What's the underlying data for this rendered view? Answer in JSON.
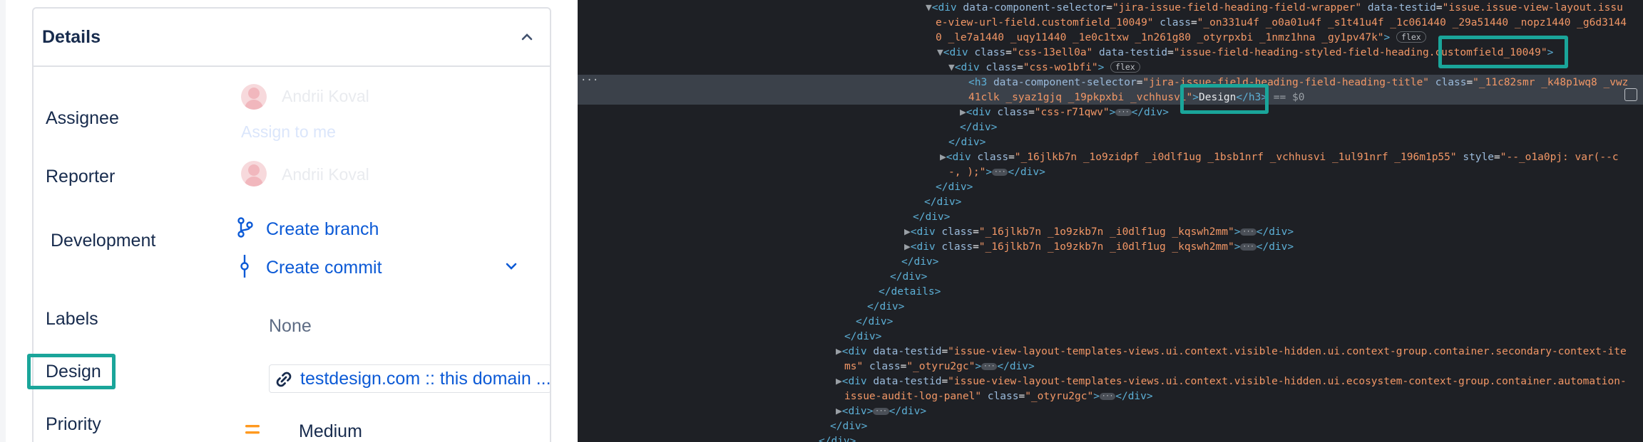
{
  "details": {
    "title": "Details",
    "rows": {
      "assignee_label": "Assignee",
      "assignee_name": "Andrii Koval",
      "assign_to_me": "Assign to me",
      "reporter_label": "Reporter",
      "reporter_name": "Andrii Koval",
      "development_label": "Development",
      "create_branch": "Create branch",
      "create_commit": "Create commit",
      "labels_label": "Labels",
      "labels_value": "None",
      "design_label": "Design",
      "design_link": "testdesign.com :: this domain ...",
      "priority_label": "Priority",
      "priority_value": "Medium"
    }
  },
  "colors": {
    "accent_highlight": "#1aa59a",
    "link": "#0c5ad6",
    "devtools_bg": "#1e2025",
    "selected_row": "#3b414a"
  },
  "devtools": {
    "l1a": "div",
    "l1_attr1": "data-component-selector",
    "l1_val1": "\"jira-issue-field-heading-field-wrapper\"",
    "l1_attr2": "data-testid",
    "l1_val2a": "\"issue.issue-view-layout.issu",
    "l2_val2b": "e-view-url-field.customfield_10049\"",
    "l2_attr3": "class",
    "l2_val3a": "\"_on331u4f _o0a01u4f _s1t41u4f _1c061440 _29a51440 _nopz1440 _g6d3144",
    "l3_val3b": "0 _le7a1440 _uqy11440 _1e0c1txw _1n261g80 _otyrpxbi _1nmz1hna _gy1pv47k\"",
    "badge_flex": "flex",
    "l4_attr1": "class",
    "l4_val1": "\"css-13ell0a\"",
    "l4_attr2": "data-testid",
    "l4_val2": "\"issue-field-heading-styled-field-heading.customfield_10049\"",
    "l5_val": "\"css-wo1bfi\"",
    "l6_attr1": "data-component-selector",
    "l6_val1": "\"jira-issue-field-heading-field-heading-title\"",
    "l6_attr2": "class",
    "l6_val2a": "\"_11c82smr _k48p1wq8 _vwz",
    "l7_val2b": "41clk _syaz1gjq _19pkpxbi _vchhusvi\"",
    "l7_text": "Design",
    "l7_eq": " == $0",
    "l8_val": "\"css-r71qwv\"",
    "l11_val": "\"_16jlkb7n _1o9zidpf _i0dlf1ug _1bsb1nrf _vchhusvi _1ul91nrf _196m1p55\"",
    "l11_attr2": "style",
    "l11_val2": "\"--_o1a0pj: var(--c",
    "l12_val": "-, );\"",
    "l15_val": "\"_16jlkb7n _1o9zkb7n _i0dlf1ug _kqswh2mm\"",
    "l21_val": "\"issue-view-layout-templates-views.ui.context.visible-hidden.ui.context-group.container.secondary-context-ite",
    "l22_val": "ms\"",
    "l22_class": "\"_otyru2gc\"",
    "l23_val": "\"issue-view-layout-templates-views.ui.context.visible-hidden.ui.ecosystem-context-group.container.automation-",
    "l24_val": "issue-audit-log-panel\"",
    "tag_div": "div",
    "tag_h3": "h3",
    "tag_details": "details",
    "attr_class": "class",
    "attr_testid": "data-testid",
    "ellipsis": "···",
    "dots": "···"
  }
}
